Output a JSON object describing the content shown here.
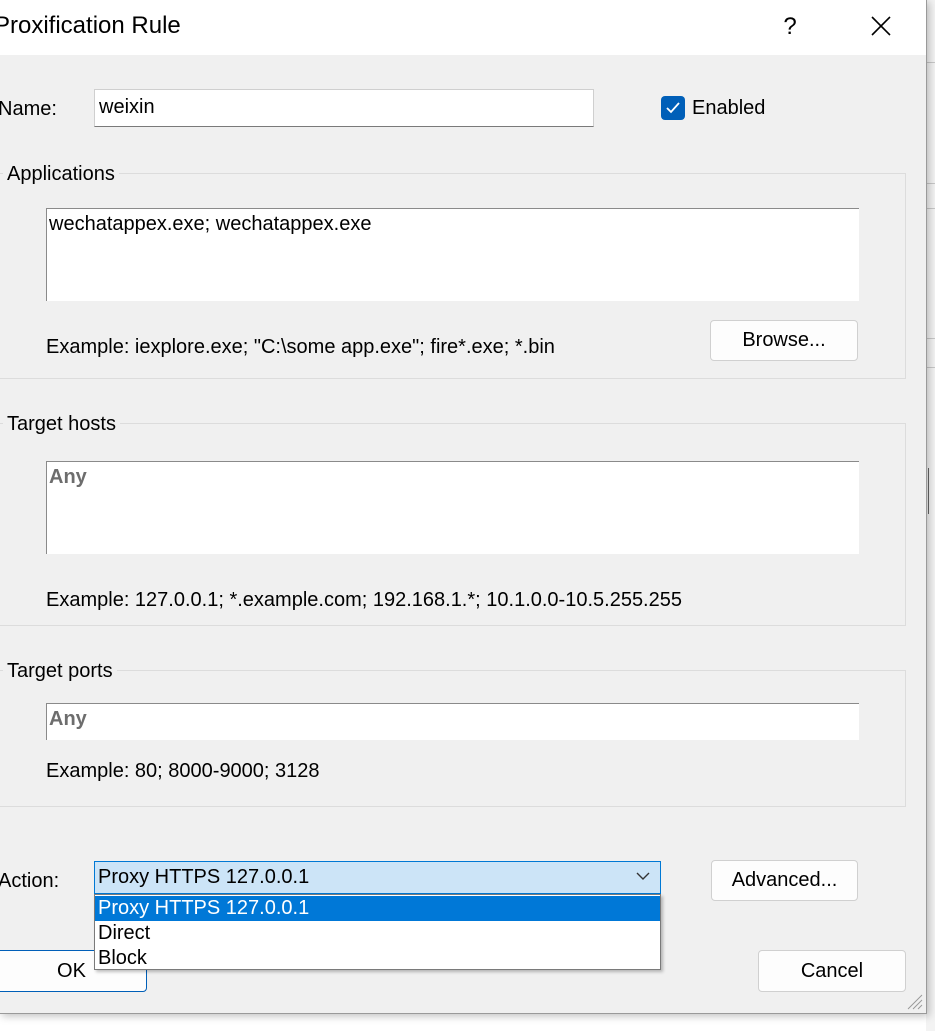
{
  "dialog": {
    "title": "Proxification Rule",
    "help_label": "?",
    "close_icon": "close-icon"
  },
  "name": {
    "label": "Name:",
    "value": "weixin"
  },
  "enabled": {
    "label": "Enabled",
    "checked": true
  },
  "applications": {
    "title": "Applications",
    "value": "wechatappex.exe; wechatappex.exe",
    "example": "Example: iexplore.exe; \"C:\\some app.exe\"; fire*.exe; *.bin",
    "browse_label": "Browse..."
  },
  "target_hosts": {
    "title": "Target hosts",
    "value": "Any",
    "example": "Example: 127.0.0.1; *.example.com; 192.168.1.*; 10.1.0.0-10.5.255.255"
  },
  "target_ports": {
    "title": "Target ports",
    "value": "Any",
    "example": "Example: 80; 8000-9000; 3128"
  },
  "action": {
    "label": "Action:",
    "selected": "Proxy HTTPS 127.0.0.1",
    "options": [
      "Proxy HTTPS 127.0.0.1",
      "Direct",
      "Block"
    ],
    "advanced_label": "Advanced..."
  },
  "buttons": {
    "ok_label": "OK",
    "cancel_label": "Cancel"
  },
  "colors": {
    "accent": "#005fb8",
    "selection": "#0078d7",
    "dialog_bg": "#f0f0f0"
  }
}
